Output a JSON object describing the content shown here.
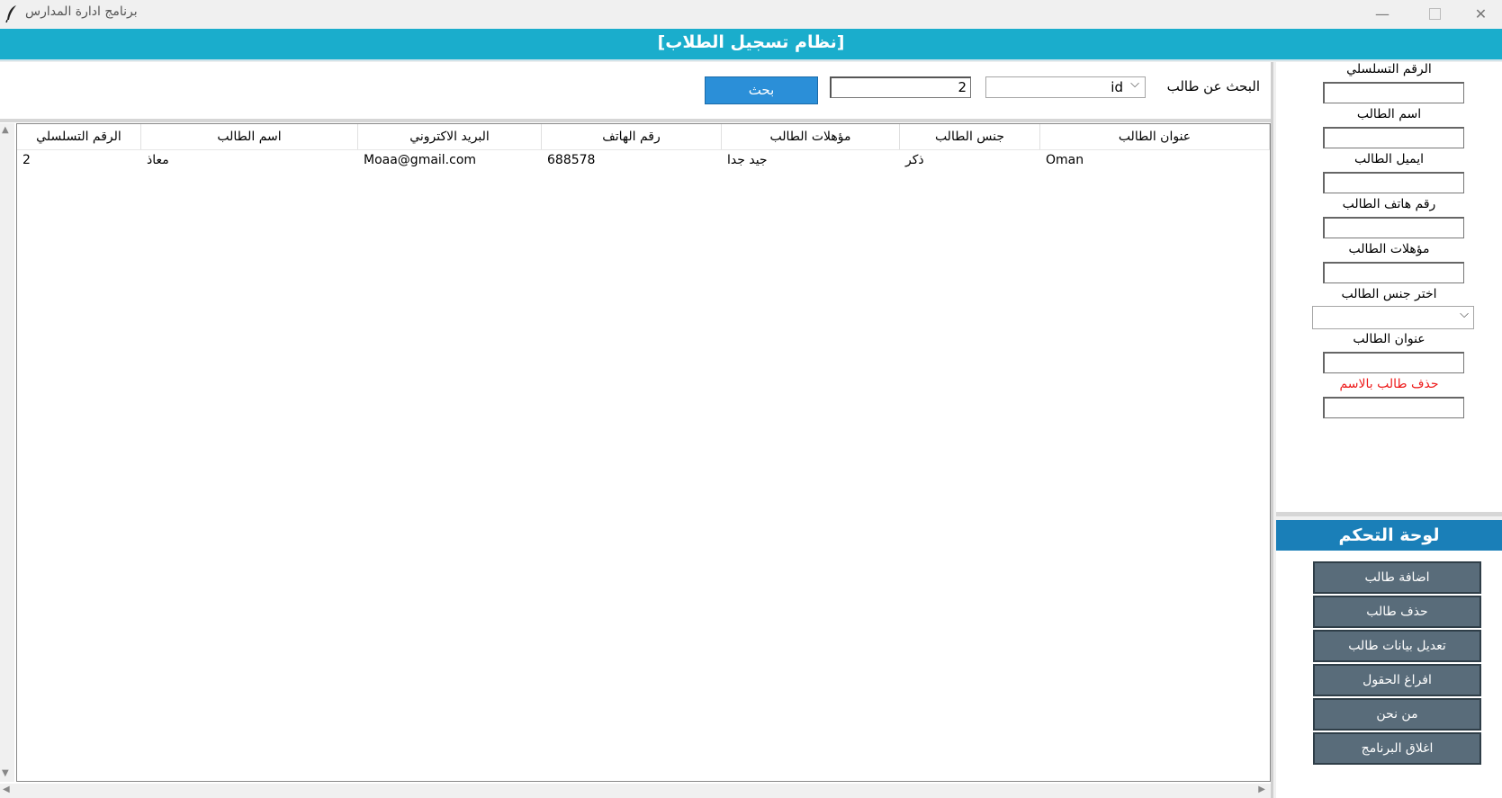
{
  "window": {
    "title": "برنامج ادارة المدارس",
    "minimize_glyph": "—",
    "close_glyph": "✕"
  },
  "header": {
    "title": "[نظام تسجيل الطلاب]"
  },
  "search": {
    "label": "البحث عن طالب",
    "field_selected": "id",
    "query_value": "2",
    "button_label": "بحث"
  },
  "table": {
    "columns": [
      "الرقم التسلسلي",
      "اسم الطالب",
      "البريد الاكتروني",
      "رقم الهاتف",
      "مؤهلات الطالب",
      "جنس الطالب",
      "عنوان الطالب"
    ],
    "rows": [
      {
        "serial": "2",
        "name": "معاذ",
        "email": "Moaa@gmail.com",
        "phone": "688578",
        "qualification": "جيد جدا",
        "gender": "ذكر",
        "address": "Oman"
      }
    ]
  },
  "form": {
    "serial_label": "الرقم التسلسلي",
    "name_label": "اسم الطالب",
    "email_label": "ايميل الطالب",
    "phone_label": "رقم هاتف الطالب",
    "qualification_label": "مؤهلات الطالب",
    "gender_label": "اختر جنس الطالب",
    "address_label": "عنوان الطالب",
    "delete_by_name_label": "حذف طالب بالاسم"
  },
  "control_panel": {
    "title": "لوحة التحكم",
    "buttons": [
      "اضافة طالب",
      "حذف طالب",
      "تعديل بيانات طالب",
      "افراغ الحقول",
      "من نحن",
      "اغلاق البرنامج"
    ]
  },
  "colors": {
    "header_bg": "#1aadcc",
    "panel_header_bg": "#1a7fb8",
    "search_button_bg": "#2b8fd8",
    "control_button_bg": "#596c7a",
    "danger_text": "#ee1c1c"
  }
}
